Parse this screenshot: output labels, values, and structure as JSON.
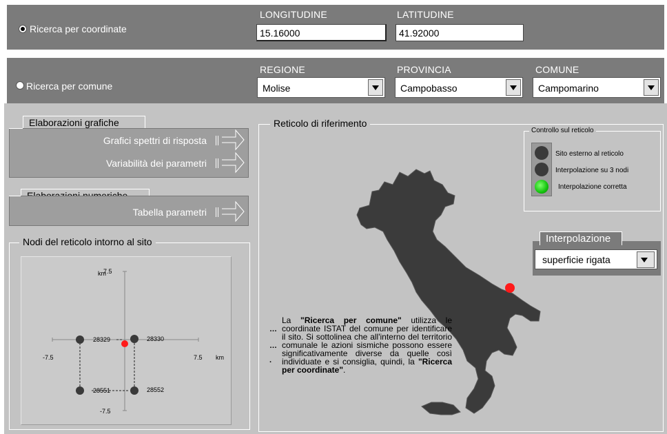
{
  "search_coords": {
    "label": "Ricerca per coordinate",
    "selected": true,
    "longitude_header": "LONGITUDINE",
    "latitude_header": "LATITUDINE",
    "longitude_value": "15.16000",
    "latitude_value": "41.92000"
  },
  "search_comune": {
    "label": "Ricerca per comune",
    "selected": false,
    "regione_header": "REGIONE",
    "provincia_header": "PROVINCIA",
    "comune_header": "COMUNE",
    "regione_value": "Molise",
    "provincia_value": "Campobasso",
    "comune_value": "Campomarino"
  },
  "graphic": {
    "title": "Elaborazioni grafiche",
    "btn_spectra": "Grafici spettri di risposta",
    "btn_params": "Variabilità dei parametri"
  },
  "numeric": {
    "title": "Elaborazioni numeriche",
    "btn_table": "Tabella parametri"
  },
  "nodes": {
    "title": "Nodi del reticolo intorno al sito",
    "km_top": "km",
    "top_value": "7.5",
    "left_value": "-7.5",
    "right_value": "7.5",
    "right_unit": "km",
    "bottom_value": "-7.5",
    "node_tl": "28329",
    "node_tr": "28330",
    "node_bl": "28551",
    "node_br": "28552"
  },
  "grid": {
    "title": "Reticolo di riferimento",
    "control_title": "Controllo sul reticolo",
    "ctl_external": "Sito esterno al reticolo",
    "ctl_3nodes": "Interpolazione su 3 nodi",
    "ctl_correct": "Interpolazione corretta",
    "interp_title": "Interpolazione",
    "interp_value": "superficie rigata"
  },
  "info": {
    "p1": "La ",
    "bold1": "\"Ricerca per comune\"",
    "p2": " utilizza le coordinate ISTAT del comune per identificare il sito.  Si sottolinea che all'interno del territorio comunale le azioni sismiche possono essere significativamente diverse da quelle così individuate e si consiglia, quindi, la ",
    "bold2": "\"Ricerca per coordinate\"",
    "p3": "."
  },
  "colors": {
    "header_bar": "#7b7b7b",
    "panel": "#c3c3c3",
    "map": "#3b3b3b",
    "site_marker": "#ff1a1a",
    "lamp_on": "#19d414"
  }
}
